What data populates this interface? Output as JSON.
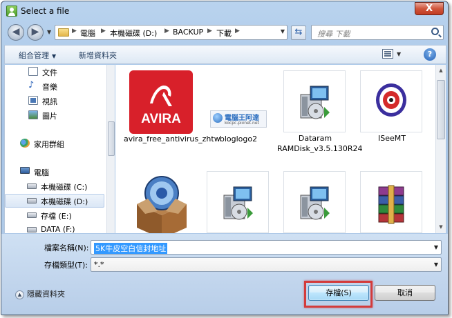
{
  "window": {
    "title": "Select a file",
    "close_label": "X"
  },
  "nav": {
    "back_glyph": "◀",
    "forward_glyph": "▶"
  },
  "address": {
    "crumbs": [
      "電腦",
      "本機磁碟 (D:)",
      "BACKUP",
      "下載"
    ]
  },
  "search": {
    "placeholder": "搜尋 下載"
  },
  "toolbar": {
    "organize": "組合管理",
    "new_folder": "新增資料夾",
    "help": "?"
  },
  "sidebar": {
    "items": [
      {
        "label": "文件",
        "icon": "document-icon"
      },
      {
        "label": "音樂",
        "icon": "music-icon"
      },
      {
        "label": "視訊",
        "icon": "video-icon"
      },
      {
        "label": "圖片",
        "icon": "picture-icon"
      },
      {
        "label": "家用群組",
        "icon": "homegroup-icon"
      },
      {
        "label": "電腦",
        "icon": "computer-icon"
      },
      {
        "label": "本機磁碟 (C:)",
        "icon": "drive-icon"
      },
      {
        "label": "本機磁碟 (D:)",
        "icon": "drive-icon",
        "selected": true
      },
      {
        "label": "存檔 (E:)",
        "icon": "drive-icon"
      },
      {
        "label": "DATA (F:)",
        "icon": "drive-icon"
      }
    ]
  },
  "files": [
    {
      "label": "avira_free_antivirus_zhtw",
      "icon": "avira-icon",
      "logo_text": "AVIRA"
    },
    {
      "label": "bloglogo2",
      "icon": "blog-logo-image",
      "logo_text": "電腦王阿達",
      "logo_sub": "kocpc.pixnet.net"
    },
    {
      "label": "Dataram RAMDisk_v3.5.130R24",
      "icon": "installer-icon"
    },
    {
      "label": "ISeeMT",
      "icon": "iseemt-icon"
    },
    {
      "label": "",
      "icon": "itunes-package-icon"
    },
    {
      "label": "",
      "icon": "installer-icon"
    },
    {
      "label": "",
      "icon": "installer-icon"
    },
    {
      "label": "",
      "icon": "winrar-icon"
    }
  ],
  "form": {
    "filename_label": "檔案名稱(N):",
    "filename_value": "5K牛皮空白信封地址",
    "filetype_label": "存檔類型(T):",
    "filetype_value": "*.*"
  },
  "footer": {
    "hide_folders": "隱藏資料夾",
    "save_button": "存檔(S)",
    "cancel_button": "取消"
  },
  "colors": {
    "highlight": "#d33b3b",
    "selection": "#3399ff",
    "avira_red": "#d8202a"
  }
}
